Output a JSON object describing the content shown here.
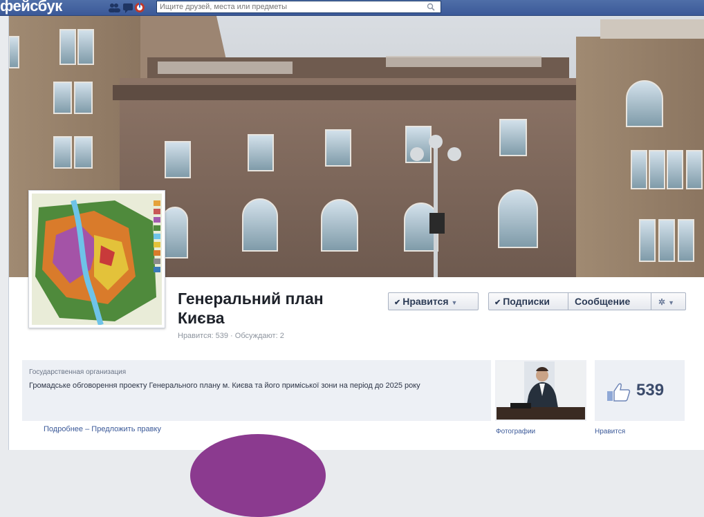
{
  "topbar": {
    "logo": "фейсбук",
    "search_placeholder": "Ищите друзей, места или предметы"
  },
  "page": {
    "title": "Генеральний план Києва",
    "stats": "Нравится: 539 · Обсуждают: 2"
  },
  "actions": {
    "like_label": "Нравится",
    "follow_label": "Подписки",
    "message_label": "Сообщение"
  },
  "about": {
    "category": "Государственная организация",
    "description": "Громадське обговорення проекту Генерального плану м. Києва та його приміської зони на період до 2025 року",
    "more_link": "Подробнее",
    "separator": "–",
    "suggest_link": "Предложить правку"
  },
  "tiles": {
    "photos_label": "Фотографии",
    "likes_count": "539",
    "likes_label": "Нравится"
  },
  "colors": {
    "brand": "#3b5998",
    "accent_purple": "#8b3a8f"
  }
}
